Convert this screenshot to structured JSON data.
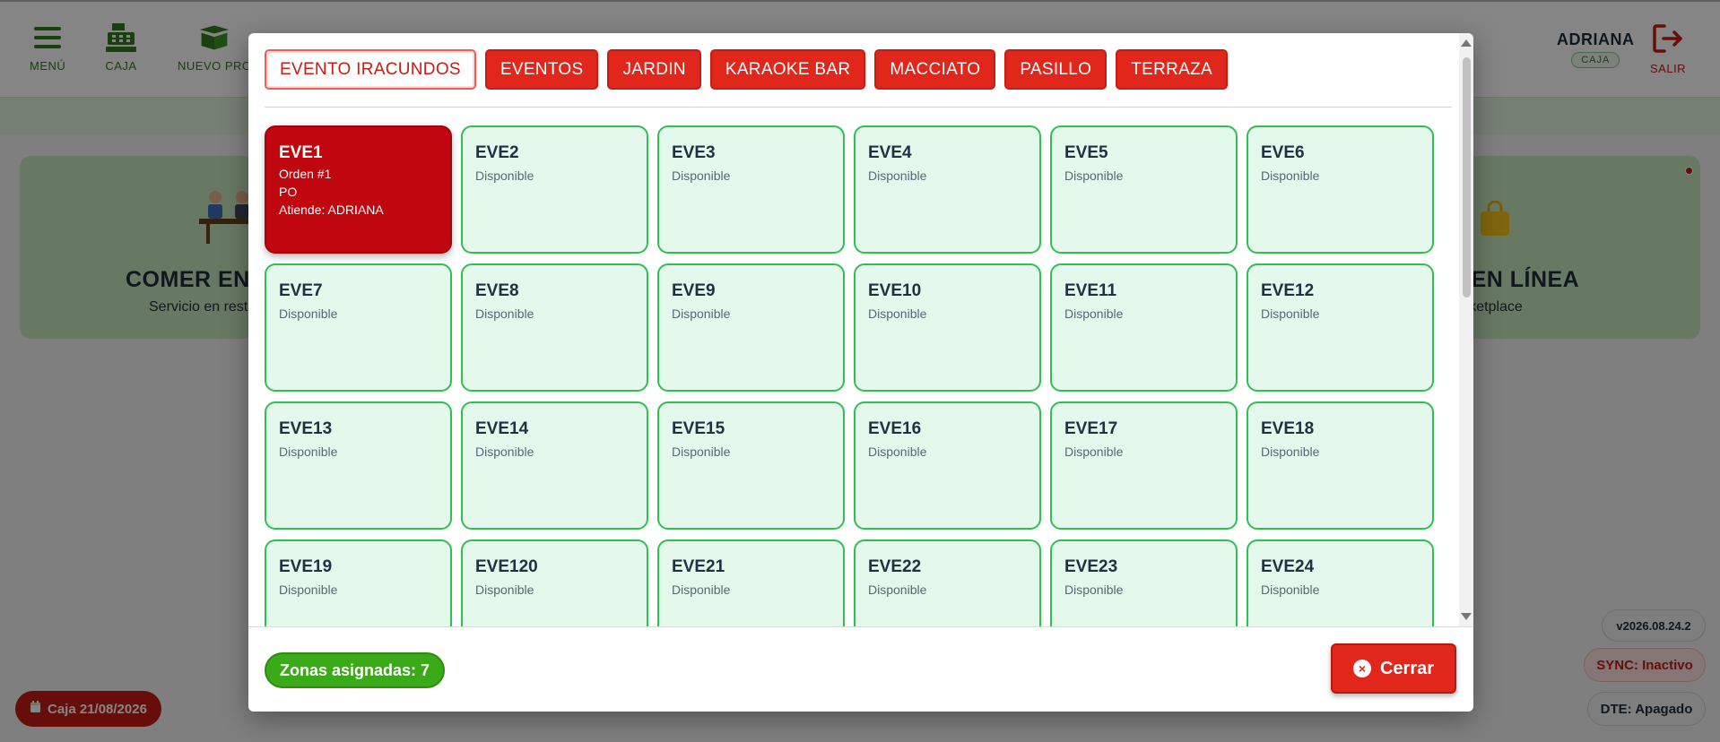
{
  "topbar": {
    "nav": [
      {
        "label": "MENÚ",
        "icon": "hamburger-menu-icon"
      },
      {
        "label": "CAJA",
        "icon": "cash-register-icon"
      },
      {
        "label": "NUEVO PRO",
        "icon": "new-product-box-icon"
      }
    ],
    "user": {
      "name": "ADRIANA",
      "role": "CAJA"
    },
    "logout_label": "SALIR"
  },
  "services": {
    "left": {
      "title": "COMER EN",
      "subtitle": "Servicio en rest"
    },
    "right": {
      "title": "OS EN LÍNEA",
      "subtitle": "arketplace"
    }
  },
  "footer_chips": {
    "caja_date": "Caja 21/08/2026",
    "version": "v2026.08.24.2",
    "sync": "SYNC: Inactivo",
    "dte": "DTE: Apagado"
  },
  "modal": {
    "zones": [
      "EVENTO IRACUNDOS",
      "EVENTOS",
      "JARDIN",
      "KARAOKE BAR",
      "MACCIATO",
      "PASILLO",
      "TERRAZA"
    ],
    "active_zone": "EVENTO IRACUNDOS",
    "tables": [
      {
        "name": "EVE1",
        "status": "occupied",
        "lines": [
          "Orden #1",
          "PO",
          "Atiende: ADRIANA"
        ]
      },
      {
        "name": "EVE2",
        "status": "Disponible"
      },
      {
        "name": "EVE3",
        "status": "Disponible"
      },
      {
        "name": "EVE4",
        "status": "Disponible"
      },
      {
        "name": "EVE5",
        "status": "Disponible"
      },
      {
        "name": "EVE6",
        "status": "Disponible"
      },
      {
        "name": "EVE7",
        "status": "Disponible"
      },
      {
        "name": "EVE8",
        "status": "Disponible"
      },
      {
        "name": "EVE9",
        "status": "Disponible"
      },
      {
        "name": "EVE10",
        "status": "Disponible"
      },
      {
        "name": "EVE11",
        "status": "Disponible"
      },
      {
        "name": "EVE12",
        "status": "Disponible"
      },
      {
        "name": "EVE13",
        "status": "Disponible"
      },
      {
        "name": "EVE14",
        "status": "Disponible"
      },
      {
        "name": "EVE15",
        "status": "Disponible"
      },
      {
        "name": "EVE16",
        "status": "Disponible"
      },
      {
        "name": "EVE17",
        "status": "Disponible"
      },
      {
        "name": "EVE18",
        "status": "Disponible"
      },
      {
        "name": "EVE19",
        "status": "Disponible"
      },
      {
        "name": "EVE120",
        "status": "Disponible"
      },
      {
        "name": "EVE21",
        "status": "Disponible"
      },
      {
        "name": "EVE22",
        "status": "Disponible"
      },
      {
        "name": "EVE23",
        "status": "Disponible"
      },
      {
        "name": "EVE24",
        "status": "Disponible"
      }
    ],
    "zones_assigned_label": "Zonas asignadas: 7",
    "close_label": "Cerrar"
  },
  "colors": {
    "primary_red": "#e1261c",
    "occupied_red": "#c0060e",
    "available_bg": "#e4f8ec",
    "available_border": "#2fbf52",
    "brand_green": "#2f7d1c"
  }
}
